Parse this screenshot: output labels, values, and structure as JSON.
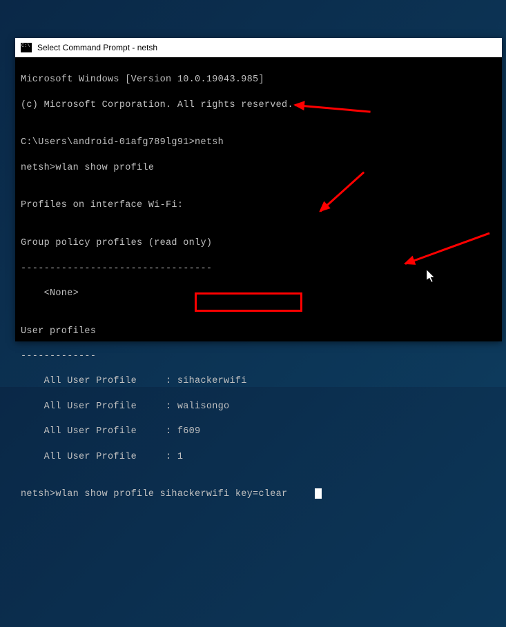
{
  "titlebar": {
    "title": "Select Command Prompt - netsh"
  },
  "terminal": {
    "l0": "Microsoft Windows [Version 10.0.19043.985]",
    "l1": "(c) Microsoft Corporation. All rights reserved.",
    "l2": "",
    "l3": "C:\\Users\\android-01afg789lg91>netsh",
    "l4": "netsh>wlan show profile",
    "l5": "",
    "l6": "Profiles on interface Wi-Fi:",
    "l7": "",
    "l8": "Group policy profiles (read only)",
    "l9": "---------------------------------",
    "l10": "    <None>",
    "l11": "",
    "l12": "User profiles",
    "l13": "-------------",
    "l14": "    All User Profile     : sihackerwifi",
    "l15": "    All User Profile     : walisongo",
    "l16": "    All User Profile     : f609",
    "l17": "    All User Profile     : 1",
    "l18": "",
    "l19": "netsh>wlan show profile sihackerwifi key=clear"
  },
  "highlighted_profile": "sihackerwifi",
  "annotations": {
    "arrow1": "arrow pointing to netsh command",
    "arrow2": "arrow pointing to sihackerwifi profile",
    "arrow3": "arrow pointing to command line",
    "box": "highlight box around sihackerwifi"
  }
}
